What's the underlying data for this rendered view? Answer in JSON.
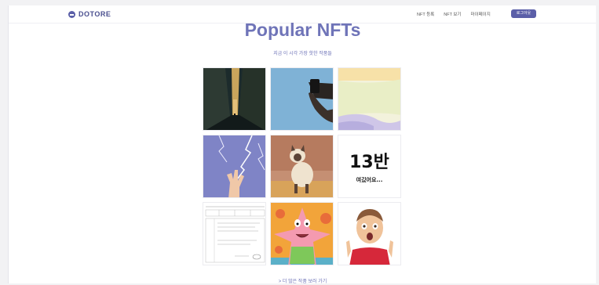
{
  "nav": {
    "logo_text": "DOTORE",
    "links": [
      "NFT 등록",
      "NFT 보기",
      "마이페이지"
    ],
    "login_label": "로그아웃"
  },
  "main": {
    "title": "Popular NFTs",
    "subtitle": "지금 이 시각 가장 핫한 작품들",
    "more_link": "> 더 많은 작품 보러 가기"
  },
  "tiles": [
    {
      "name": "alley-street-nft"
    },
    {
      "name": "hand-holding-phone-nft"
    },
    {
      "name": "pastel-abstract-nft"
    },
    {
      "name": "lightning-hand-nft"
    },
    {
      "name": "siamese-cat-nft"
    },
    {
      "name": "13ban-text-nft",
      "text_main": "13반",
      "text_sub": "여깄어요..."
    },
    {
      "name": "document-form-nft"
    },
    {
      "name": "patrick-star-nft"
    },
    {
      "name": "surprised-kid-nft"
    }
  ],
  "colors": {
    "accent": "#6f74b8",
    "brand": "#5b5fa8"
  }
}
